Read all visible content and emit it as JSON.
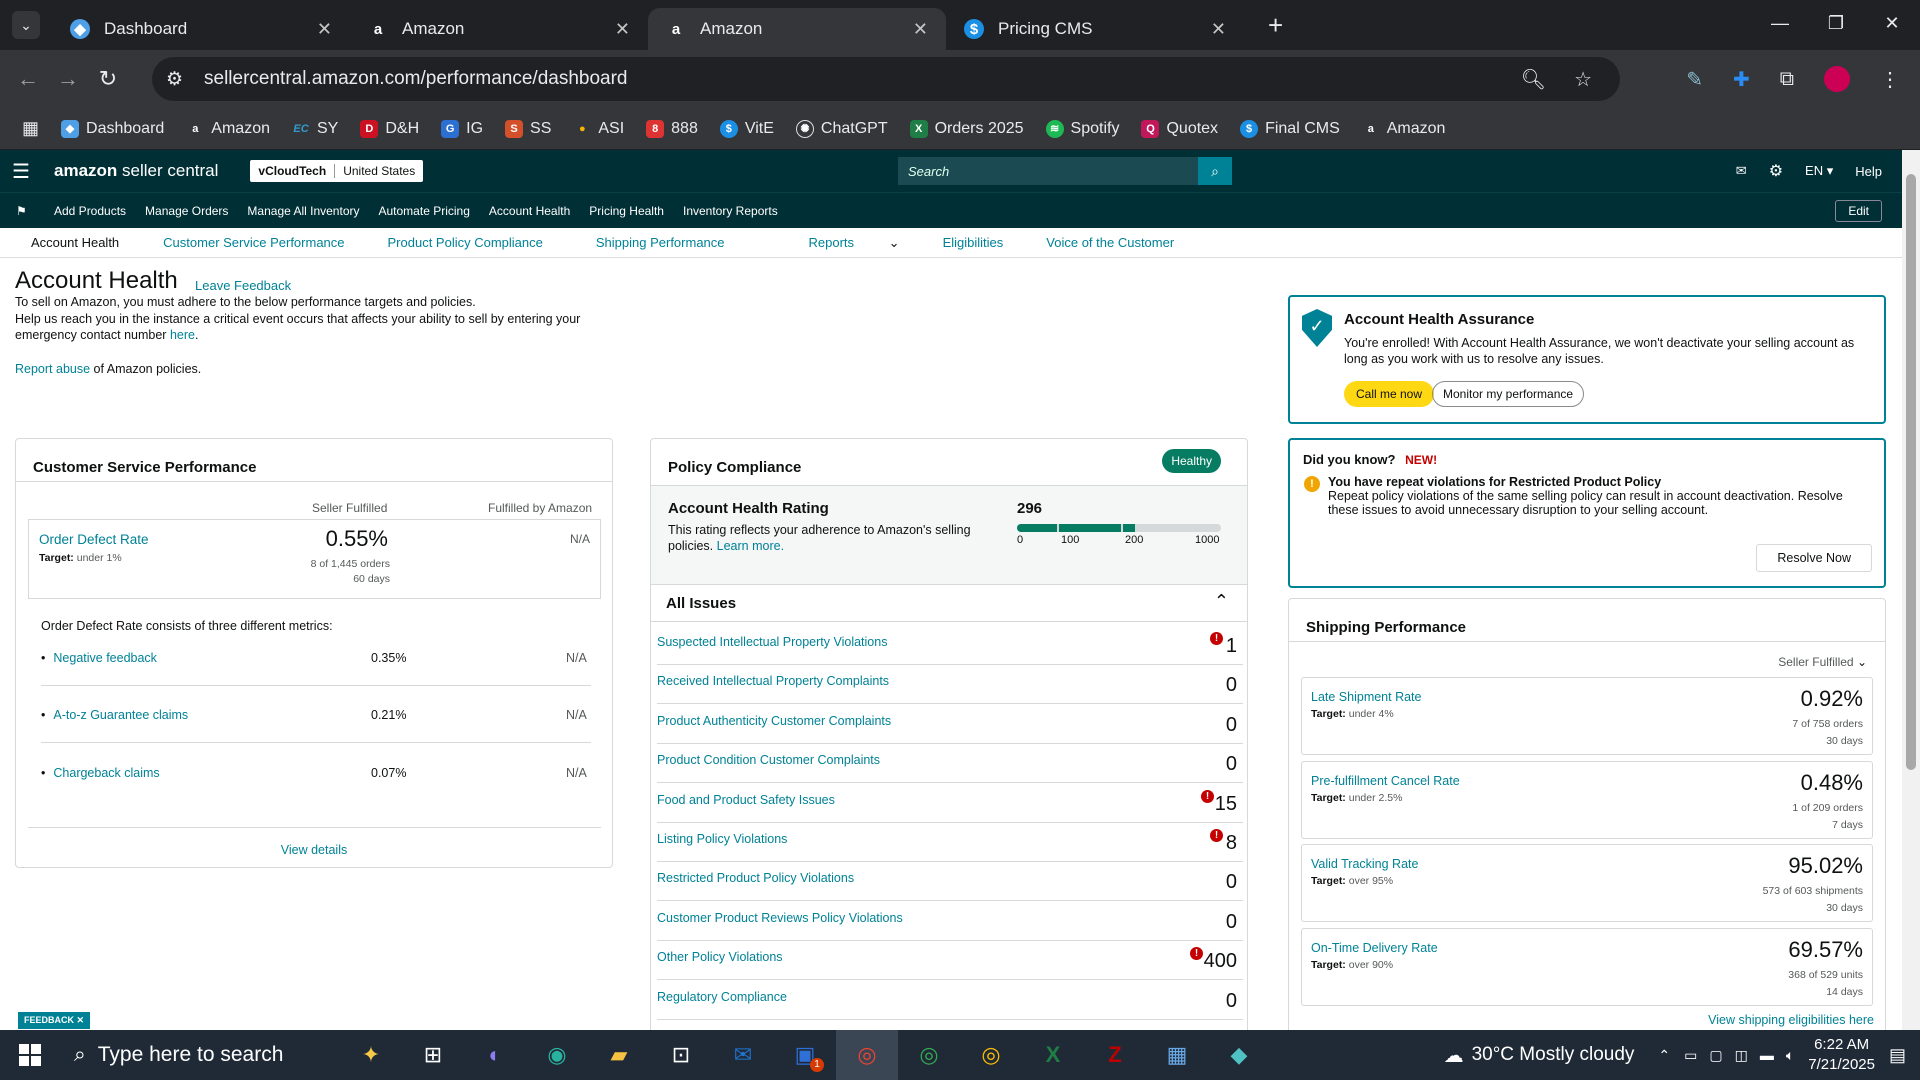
{
  "browser": {
    "tabs": [
      {
        "title": "Dashboard",
        "icon": "dashboard-favicon"
      },
      {
        "title": "Amazon",
        "icon": "amazon-favicon"
      },
      {
        "title": "Amazon",
        "icon": "amazon-favicon",
        "active": true
      },
      {
        "title": "Pricing CMS",
        "icon": "dollar-favicon"
      }
    ],
    "url": "sellercentral.amazon.com/performance/dashboard",
    "bookmarks": [
      "Dashboard",
      "Amazon",
      "SY",
      "D&H",
      "IG",
      "SS",
      "ASI",
      "888",
      "VitE",
      "ChatGPT",
      "Orders 2025",
      "Spotify",
      "Quotex",
      "Final CMS",
      "Amazon"
    ]
  },
  "seller": {
    "logo": "amazon",
    "logo_suffix": "seller central",
    "store": "vCloudTech",
    "region": "United States",
    "search_placeholder": "Search",
    "lang": "EN",
    "help": "Help",
    "nav": [
      "Add Products",
      "Manage Orders",
      "Manage All Inventory",
      "Automate Pricing",
      "Account Health",
      "Pricing Health",
      "Inventory Reports"
    ],
    "edit": "Edit",
    "subnav": [
      "Account Health",
      "Customer Service Performance",
      "Product Policy Compliance",
      "Shipping Performance",
      "Reports",
      "Eligibilities",
      "Voice of the Customer"
    ]
  },
  "page": {
    "title": "Account Health",
    "leave_feedback": "Leave Feedback",
    "intro1": "To sell on Amazon, you must adhere to the below performance targets and policies.",
    "intro2": "Help us reach you in the instance a critical event occurs that affects your ability to sell by entering your emergency contact number",
    "intro2_link": "here",
    "report_link": "Report abuse",
    "report_rest": "of Amazon policies."
  },
  "csp": {
    "title": "Customer Service Performance",
    "col1": "Seller Fulfilled",
    "col2": "Fulfilled by Amazon",
    "odr_name": "Order Defect Rate",
    "odr_target_label": "Target:",
    "odr_target": "under 1%",
    "odr_value": "0.55%",
    "odr_orders": "8 of 1,445 orders",
    "odr_days": "60 days",
    "odr_fba": "N/A",
    "desc": "Order Defect Rate consists of three different metrics:",
    "metrics": [
      {
        "name": "Negative feedback",
        "seller": "0.35%",
        "fba": "N/A"
      },
      {
        "name": "A-to-z Guarantee claims",
        "seller": "0.21%",
        "fba": "N/A"
      },
      {
        "name": "Chargeback claims",
        "seller": "0.07%",
        "fba": "N/A"
      }
    ],
    "view_details": "View details"
  },
  "policy": {
    "title": "Policy Compliance",
    "status": "Healthy",
    "ahr_title": "Account Health Rating",
    "ahr_desc": "This rating reflects your adherence to Amazon's selling policies.",
    "ahr_learn": "Learn more.",
    "ahr_score": "296",
    "ahr_score_fraction": 0.296,
    "ahr_ticks": [
      "0",
      "100",
      "200",
      "1000"
    ],
    "all_issues": "All Issues",
    "issues": [
      {
        "name": "Suspected Intellectual Property Violations",
        "count": "1",
        "alert": true
      },
      {
        "name": "Received Intellectual Property Complaints",
        "count": "0",
        "alert": false
      },
      {
        "name": "Product Authenticity Customer Complaints",
        "count": "0",
        "alert": false
      },
      {
        "name": "Product Condition Customer Complaints",
        "count": "0",
        "alert": false
      },
      {
        "name": "Food and Product Safety Issues",
        "count": "15",
        "alert": true
      },
      {
        "name": "Listing Policy Violations",
        "count": "8",
        "alert": true
      },
      {
        "name": "Restricted Product Policy Violations",
        "count": "0",
        "alert": false
      },
      {
        "name": "Customer Product Reviews Policy Violations",
        "count": "0",
        "alert": false
      },
      {
        "name": "Other Policy Violations",
        "count": "400",
        "alert": true
      },
      {
        "name": "Regulatory Compliance",
        "count": "0",
        "alert": false
      }
    ]
  },
  "aha": {
    "title": "Account Health Assurance",
    "desc": "You're enrolled! With Account Health Assurance, we won't deactivate your selling account as long as you work with us to resolve any issues.",
    "call_btn": "Call me now",
    "monitor_btn": "Monitor my performance"
  },
  "dyk": {
    "title": "Did you know?",
    "new": "NEW!",
    "headline": "You have repeat violations for Restricted Product Policy",
    "body": "Repeat policy violations of the same selling policy can result in account deactivation. Resolve these issues to avoid unnecessary disruption to your selling account.",
    "resolve": "Resolve Now"
  },
  "shipping": {
    "title": "Shipping Performance",
    "filter": "Seller Fulfilled",
    "rows": [
      {
        "name": "Late Shipment Rate",
        "target": "under 4%",
        "pct": "0.92%",
        "orders": "7 of 758 orders",
        "days": "30 days"
      },
      {
        "name": "Pre-fulfillment Cancel Rate",
        "target": "under 2.5%",
        "pct": "0.48%",
        "orders": "1 of 209 orders",
        "days": "7 days"
      },
      {
        "name": "Valid Tracking Rate",
        "target": "over 95%",
        "pct": "95.02%",
        "orders": "573 of 603 shipments",
        "days": "30 days"
      },
      {
        "name": "On-Time Delivery Rate",
        "target": "over 90%",
        "pct": "69.57%",
        "orders": "368 of 529 units",
        "days": "14 days"
      }
    ],
    "target_label": "Target:",
    "view_link": "View shipping eligibilities here"
  },
  "feedback_tag": "FEEDBACK",
  "taskbar": {
    "search": "Type here to search",
    "weather": "30°C  Mostly cloudy",
    "time": "6:22 AM",
    "date": "7/21/2025",
    "outlook_badge": "1"
  }
}
